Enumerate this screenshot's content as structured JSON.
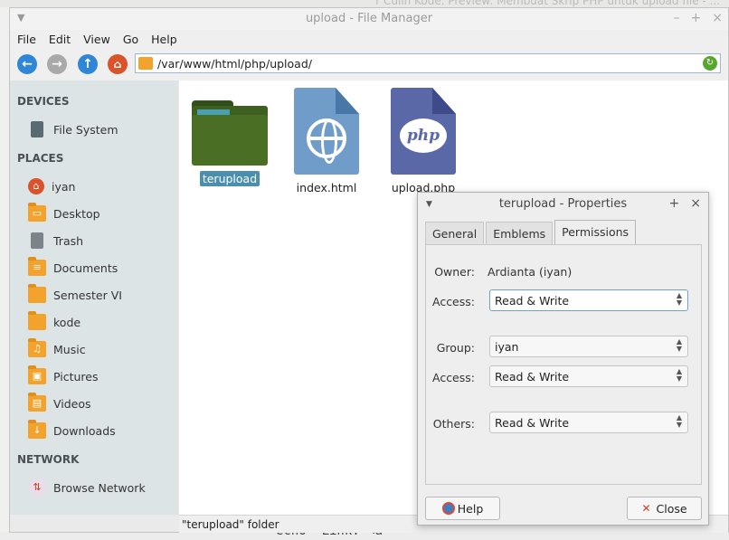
{
  "background": {
    "top_text": "r Culin Kode. Preview: Membuat Skrip PHP untuk upload file - ...",
    "code_text": "echo \"Link: <a"
  },
  "window": {
    "title": "upload - File Manager",
    "menu": [
      "File",
      "Edit",
      "View",
      "Go",
      "Help"
    ],
    "path": "/var/www/html/php/upload/"
  },
  "sidebar": {
    "devices_heading": "DEVICES",
    "devices": [
      {
        "label": "File System",
        "icon": "drive-icon"
      }
    ],
    "places_heading": "PLACES",
    "places": [
      {
        "label": "iyan",
        "icon": "home-icon"
      },
      {
        "label": "Desktop",
        "icon": "desktop-folder-icon"
      },
      {
        "label": "Trash",
        "icon": "trash-icon"
      },
      {
        "label": "Documents",
        "icon": "documents-folder-icon"
      },
      {
        "label": "Semester VI",
        "icon": "folder-icon"
      },
      {
        "label": "kode",
        "icon": "folder-icon"
      },
      {
        "label": "Music",
        "icon": "music-folder-icon"
      },
      {
        "label": "Pictures",
        "icon": "pictures-folder-icon"
      },
      {
        "label": "Videos",
        "icon": "videos-folder-icon"
      },
      {
        "label": "Downloads",
        "icon": "downloads-folder-icon"
      }
    ],
    "network_heading": "NETWORK",
    "network": [
      {
        "label": "Browse Network",
        "icon": "network-icon"
      }
    ]
  },
  "files": [
    {
      "name": "terupload",
      "type": "folder",
      "selected": true
    },
    {
      "name": "index.html",
      "type": "html"
    },
    {
      "name": "upload.php",
      "type": "php",
      "badge": "php"
    }
  ],
  "status": "\"terupload\" folder",
  "dialog": {
    "title": "terupload - Properties",
    "tabs": [
      "General",
      "Emblems",
      "Permissions"
    ],
    "active_tab": "Permissions",
    "owner_label": "Owner:",
    "owner_value": "Ardianta (iyan)",
    "owner_access_label": "Access:",
    "owner_access": "Read & Write",
    "group_label": "Group:",
    "group_value": "iyan",
    "group_access_label": "Access:",
    "group_access": "Read & Write",
    "others_label": "Others:",
    "others_access": "Read & Write",
    "help_label": "Help",
    "close_label": "Close"
  }
}
